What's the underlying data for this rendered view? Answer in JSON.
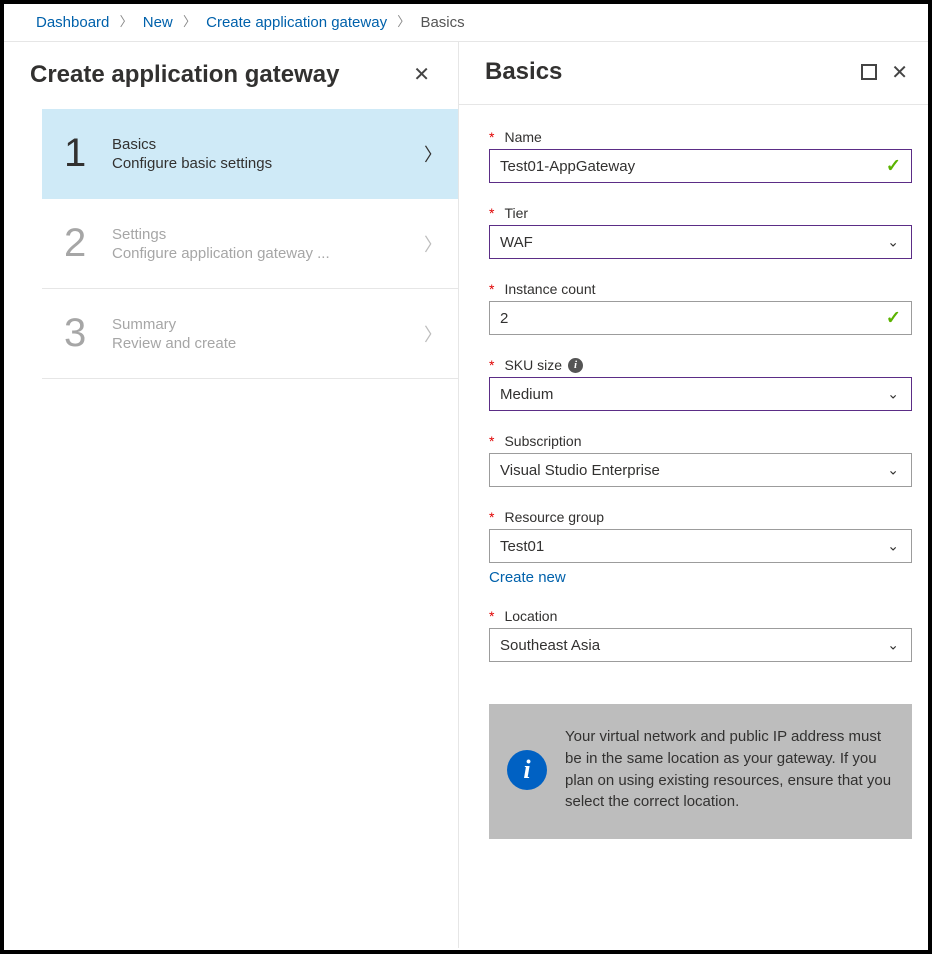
{
  "breadcrumb": {
    "items": [
      "Dashboard",
      "New",
      "Create application gateway"
    ],
    "current": "Basics"
  },
  "left": {
    "title": "Create application gateway",
    "steps": [
      {
        "num": "1",
        "title": "Basics",
        "desc": "Configure basic settings",
        "active": true
      },
      {
        "num": "2",
        "title": "Settings",
        "desc": "Configure application gateway ...",
        "active": false
      },
      {
        "num": "3",
        "title": "Summary",
        "desc": "Review and create",
        "active": false
      }
    ]
  },
  "right": {
    "title": "Basics",
    "fields": {
      "name": {
        "label": "Name",
        "value": "Test01-AppGateway",
        "type": "text",
        "valid": true,
        "accent": true
      },
      "tier": {
        "label": "Tier",
        "value": "WAF",
        "type": "select",
        "valid": false,
        "accent": true
      },
      "instance_count": {
        "label": "Instance count",
        "value": "2",
        "type": "text",
        "valid": true,
        "accent": false
      },
      "sku_size": {
        "label": "SKU size",
        "value": "Medium",
        "type": "select",
        "valid": false,
        "accent": true,
        "info": true
      },
      "subscription": {
        "label": "Subscription",
        "value": "Visual Studio Enterprise",
        "type": "select",
        "valid": false,
        "accent": false
      },
      "resource_group": {
        "label": "Resource group",
        "value": "Test01",
        "type": "select",
        "valid": false,
        "accent": false,
        "create_new": "Create new"
      },
      "location": {
        "label": "Location",
        "value": "Southeast Asia",
        "type": "select",
        "valid": false,
        "accent": false
      }
    },
    "notice": "Your virtual network and public IP address must be in the same location as your gateway. If you plan on using existing resources, ensure that you select the correct location."
  }
}
